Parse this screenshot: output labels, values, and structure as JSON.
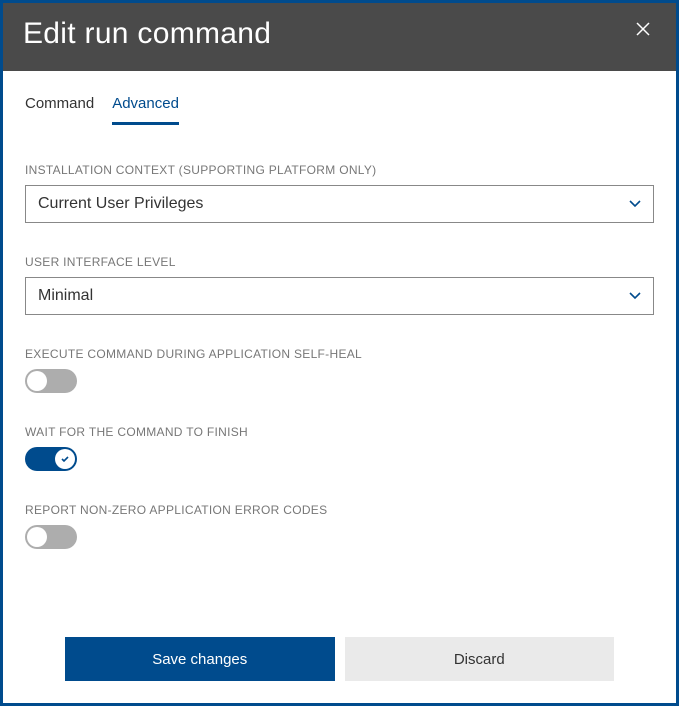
{
  "dialog": {
    "title": "Edit run command"
  },
  "tabs": {
    "command": "Command",
    "advanced": "Advanced",
    "active": "advanced"
  },
  "fields": {
    "installation_context": {
      "label": "INSTALLATION CONTEXT (SUPPORTING PLATFORM ONLY)",
      "value": "Current User Privileges"
    },
    "ui_level": {
      "label": "USER INTERFACE LEVEL",
      "value": "Minimal"
    },
    "self_heal": {
      "label": "EXECUTE COMMAND DURING APPLICATION SELF-HEAL",
      "value": false
    },
    "wait_finish": {
      "label": "WAIT FOR THE COMMAND TO FINISH",
      "value": true
    },
    "report_nonzero": {
      "label": "REPORT NON-ZERO APPLICATION ERROR CODES",
      "value": false
    }
  },
  "buttons": {
    "save": "Save changes",
    "discard": "Discard"
  }
}
